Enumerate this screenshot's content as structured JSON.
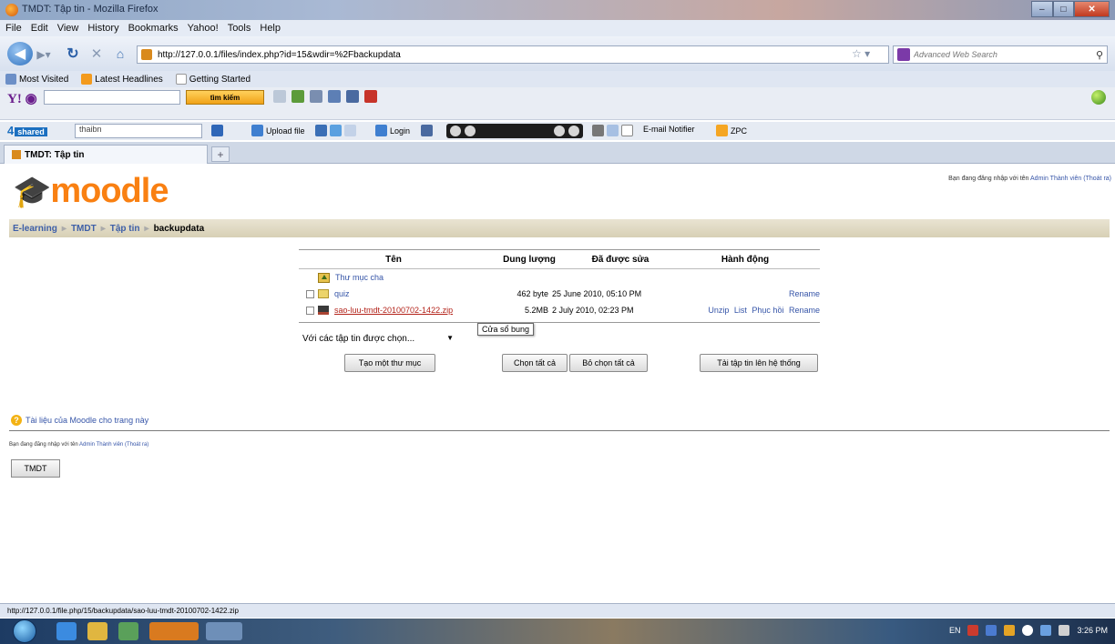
{
  "window": {
    "title": "TMDT: Tập tin - Mozilla Firefox"
  },
  "menu": [
    "File",
    "Edit",
    "View",
    "History",
    "Bookmarks",
    "Yahoo!",
    "Tools",
    "Help"
  ],
  "nav": {
    "url": "http://127.0.0.1/files/index.php?id=15&wdir=%2Fbackupdata",
    "search_placeholder": "Advanced Web Search"
  },
  "bookmarks": [
    "Most Visited",
    "Latest Headlines",
    "Getting Started"
  ],
  "yahoo_toolbar": {
    "button": "tìm kiếm"
  },
  "shared_toolbar": {
    "logo": "4",
    "logo_badge": "shared",
    "dropdown": "thaibn",
    "upload_label": "Upload file",
    "login_label": "Login",
    "email_label": "E-mail Notifier",
    "zpc_label": "ZPC"
  },
  "tab": {
    "title": "TMDT: Tập tin"
  },
  "page": {
    "logo": "moodle",
    "login_text": "Bạn đang đăng nhập với tên",
    "login_user": "Admin Thành viên",
    "logout": "(Thoát ra)",
    "breadcrumb": [
      "E-learning",
      "TMDT",
      "Tập tin",
      "backupdata"
    ],
    "table": {
      "headers": [
        "Tên",
        "Dung lượng",
        "Đã được sửa",
        "Hành động"
      ],
      "parent": "Thư mục cha",
      "rows": [
        {
          "name": "quiz",
          "size": "462 byte",
          "modified": "25 June 2010, 05:10 PM",
          "actions": [
            "Rename"
          ]
        },
        {
          "name": "sao-luu-tmdt-20100702-1422.zip",
          "size": "5.2MB",
          "modified": "2 July 2010, 02:23 PM",
          "actions": [
            "Unzip",
            "List",
            "Phục hồi",
            "Rename"
          ]
        }
      ]
    },
    "with_selected": "Với các tập tin được chọn...",
    "tooltip": "Cửa sổ bung",
    "buttons": {
      "new_folder": "Tạo một thư mục",
      "select_all": "Chọn tất cả",
      "deselect_all": "Bỏ chọn tất cả",
      "upload": "Tải tập tin lên hệ thống"
    },
    "docs_link": "Tài liệu của Moodle cho trang này",
    "footer_login_text": "Bạn đang đăng nhập với tên",
    "footer_user": "Admin Thành viên",
    "footer_logout": "(Thoát ra)",
    "home_button": "TMDT"
  },
  "status": "http://127.0.0.1/file.php/15/backupdata/sao-luu-tmdt-20100702-1422.zip",
  "taskbar": {
    "lang": "EN",
    "clock": "3:26 PM"
  }
}
